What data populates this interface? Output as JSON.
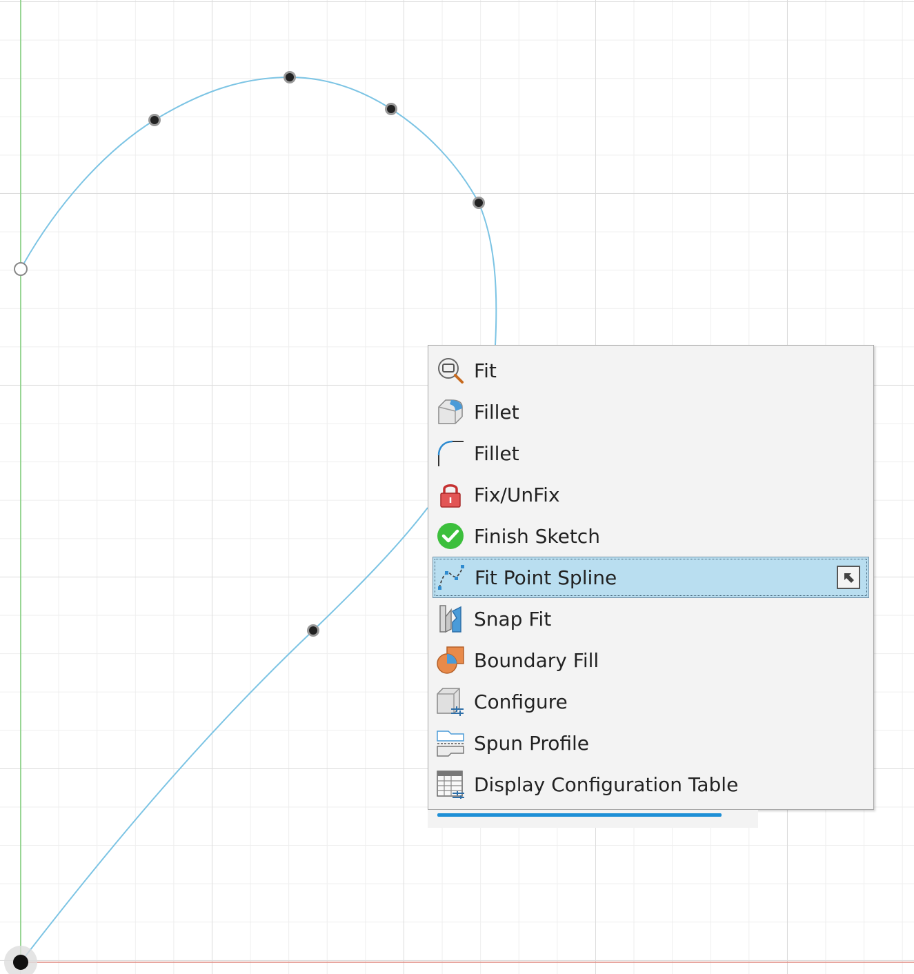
{
  "colors": {
    "spline": "#7cc4e4",
    "x_axis": "#e08a80",
    "y_axis": "#7fd07a",
    "highlight": "#b9def0",
    "menu_background": "#f3f3f3"
  },
  "sketch": {
    "spline_fit_points": 7,
    "start_point": "open-circle",
    "origin_point": "filled-circle"
  },
  "context_menu": {
    "items": [
      {
        "label": "Fit",
        "icon": "zoom-fit-icon"
      },
      {
        "label": "Fillet",
        "icon": "solid-fillet-icon"
      },
      {
        "label": "Fillet",
        "icon": "sketch-fillet-icon"
      },
      {
        "label": "Fix/UnFix",
        "icon": "lock-icon"
      },
      {
        "label": "Finish Sketch",
        "icon": "checkmark-icon"
      },
      {
        "label": "Fit Point Spline",
        "icon": "fit-point-spline-icon",
        "highlighted": true
      },
      {
        "label": "Snap Fit",
        "icon": "snap-fit-icon"
      },
      {
        "label": "Boundary Fill",
        "icon": "boundary-fill-icon"
      },
      {
        "label": "Configure",
        "icon": "configure-icon"
      },
      {
        "label": "Spun Profile",
        "icon": "spun-profile-icon"
      },
      {
        "label": "Display Configuration Table",
        "icon": "config-table-icon"
      }
    ]
  }
}
